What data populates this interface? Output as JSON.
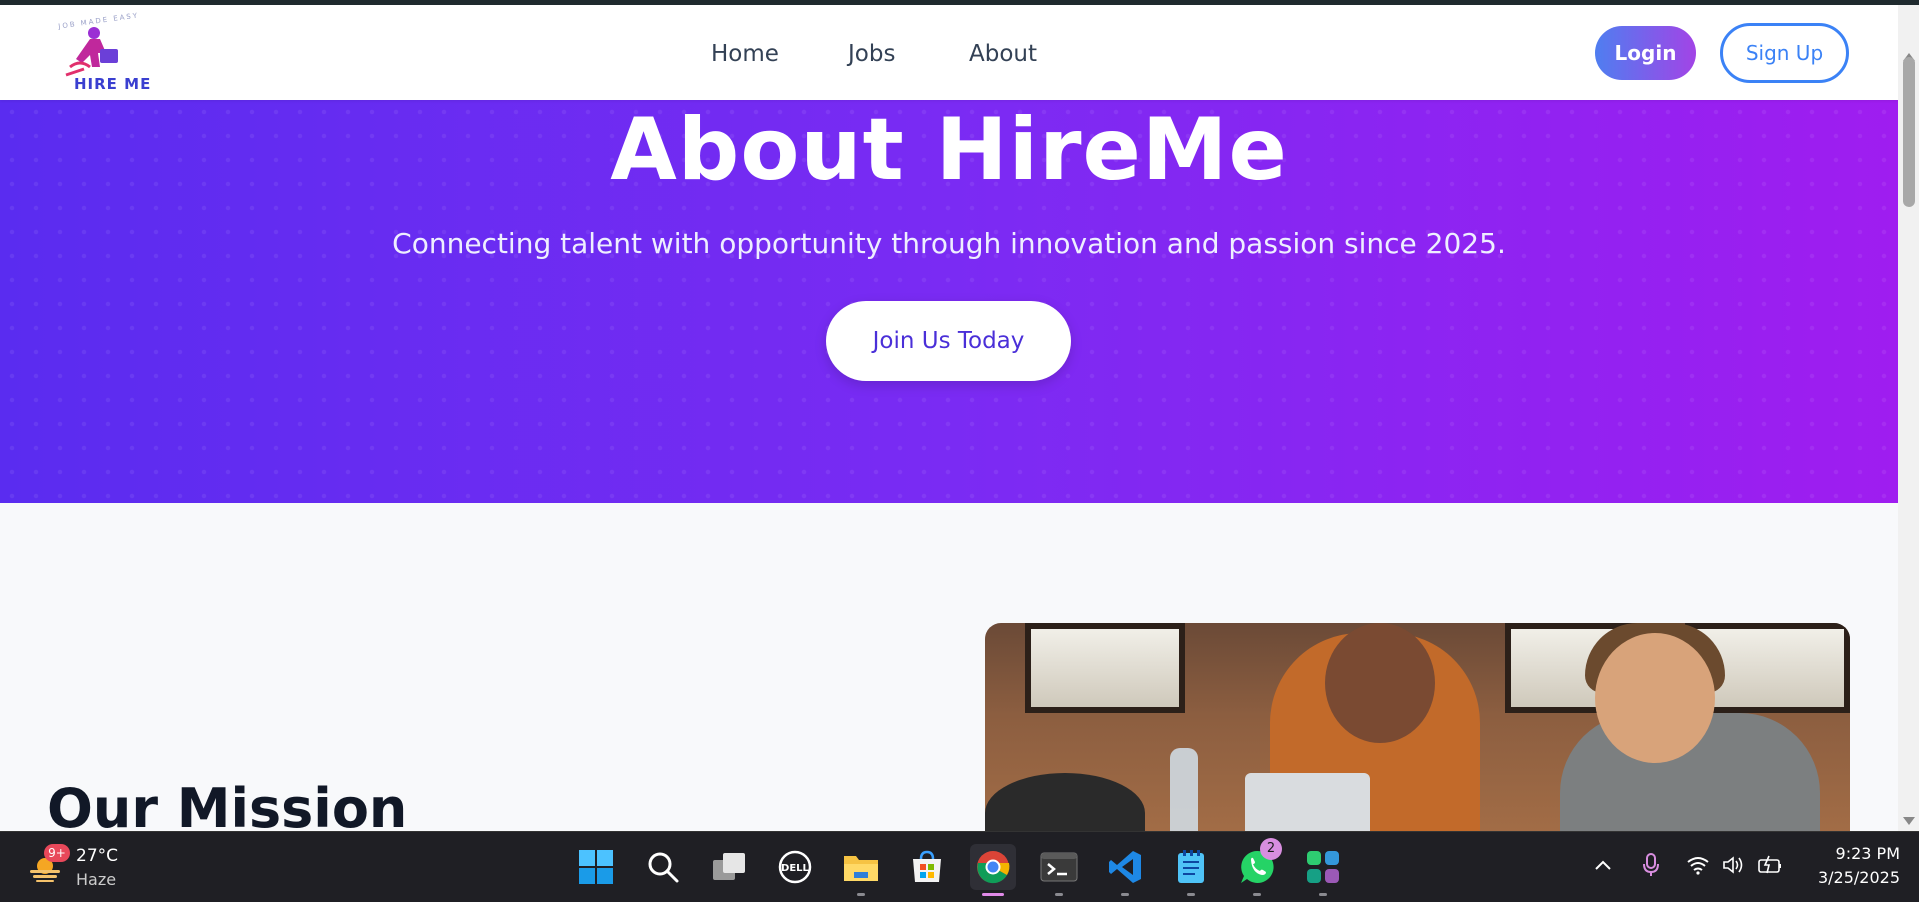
{
  "nav": {
    "logo_text": "HIRE ME",
    "logo_tagline": "JOB MADE EASY",
    "links": [
      "Home",
      "Jobs",
      "About"
    ],
    "login_label": "Login",
    "signup_label": "Sign Up",
    "colors": {
      "accent_blue": "#3b82f6",
      "gradient_start": "#4f7ef0",
      "gradient_end": "#a244e6"
    }
  },
  "hero": {
    "title": "About HireMe",
    "subtitle": "Connecting talent with opportunity through innovation and passion since 2025.",
    "cta_label": "Join Us Today",
    "colors": {
      "gradient_start": "#5a2cf0",
      "gradient_end": "#9f1df0"
    }
  },
  "mission": {
    "title": "Our Mission"
  },
  "taskbar": {
    "weather": {
      "temp": "27°C",
      "condition": "Haze",
      "badge": "9+"
    },
    "apps": [
      {
        "name": "start-icon"
      },
      {
        "name": "search-icon"
      },
      {
        "name": "task-view-icon"
      },
      {
        "name": "dell-icon"
      },
      {
        "name": "file-explorer-icon"
      },
      {
        "name": "microsoft-store-icon"
      },
      {
        "name": "chrome-icon",
        "active": true
      },
      {
        "name": "terminal-icon"
      },
      {
        "name": "vscode-icon"
      },
      {
        "name": "notepad-icon"
      },
      {
        "name": "whatsapp-icon",
        "badge": "2"
      },
      {
        "name": "app-icon"
      }
    ],
    "clock": {
      "time": "9:23 PM",
      "date": "3/25/2025"
    }
  }
}
